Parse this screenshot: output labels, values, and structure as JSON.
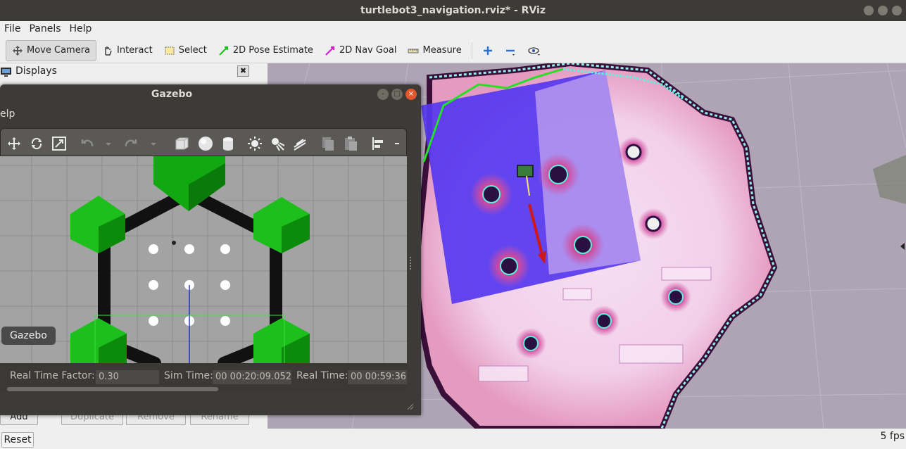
{
  "window": {
    "title": "turtlebot3_navigation.rviz* - RViz"
  },
  "menu": [
    "File",
    "Panels",
    "Help"
  ],
  "toolbar": {
    "move_camera": "Move Camera",
    "interact": "Interact",
    "select": "Select",
    "pose_estimate": "2D Pose Estimate",
    "nav_goal": "2D Nav Goal",
    "measure": "Measure"
  },
  "displays_panel": {
    "title": "Displays",
    "buttons": {
      "add": "Add",
      "duplicate": "Duplicate",
      "remove": "Remove",
      "rename": "Rename"
    }
  },
  "status": {
    "reset": "Reset",
    "fps": "5 fps"
  },
  "gazebo": {
    "title": "Gazebo",
    "menu_fragment": "elp",
    "tooltip": "Gazebo",
    "real_time_factor_label": "Real Time Factor:",
    "real_time_factor": "0.30",
    "sim_time_label": "Sim Time:",
    "sim_time": "00 00:20:09.052",
    "real_time_label": "Real Time:",
    "real_time": "00 00:59:36"
  },
  "colors": {
    "titlebar": "#3c3b37",
    "costmap_inner": "#5a3cf0",
    "costmap_free": "#f4d9f0",
    "obstacle_green": "#1faa1f",
    "plan_arrow": "#cc1a1a"
  }
}
